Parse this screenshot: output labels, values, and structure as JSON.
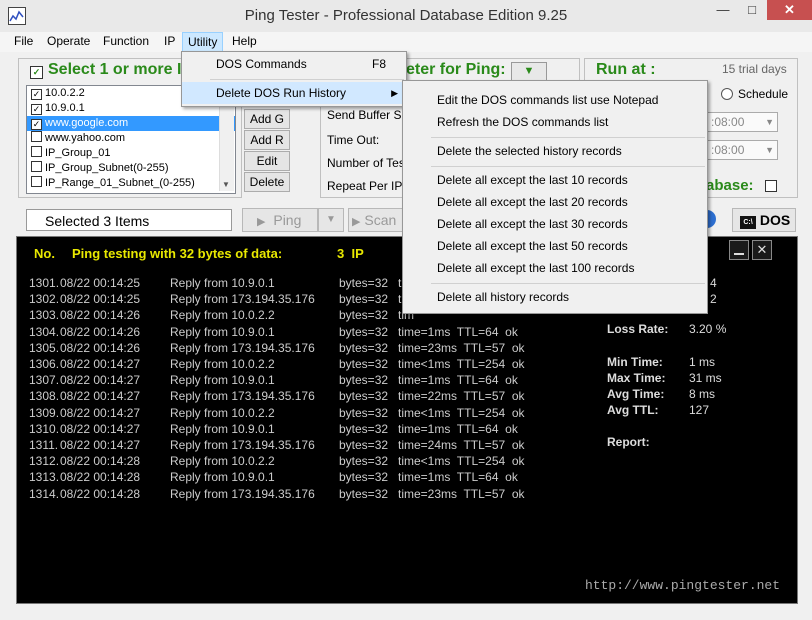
{
  "window": {
    "title": "Ping Tester - Professional Database Edition  9.25",
    "controls": {
      "minimize": "—",
      "maximize": "□",
      "close": "✕"
    }
  },
  "menubar": [
    "File",
    "Operate",
    "Function",
    "IP",
    "Utility",
    "Help"
  ],
  "left_panel": {
    "heading": "Select 1 or more I",
    "hosts": [
      {
        "label": "10.0.2.2",
        "checked": true
      },
      {
        "label": "10.9.0.1",
        "checked": true
      },
      {
        "label": "www.google.com",
        "checked": true,
        "selected": true
      },
      {
        "label": "www.yahoo.com",
        "checked": false
      },
      {
        "label": "IP_Group_01",
        "checked": false
      },
      {
        "label": "IP_Group_Subnet(0-255)",
        "checked": false
      },
      {
        "label": "IP_Range_01_Subnet_(0-255)",
        "checked": false
      }
    ],
    "buttons": [
      "Add G",
      "Add R",
      "Edit",
      "Delete"
    ]
  },
  "middle_panel": {
    "heading_suffix": "eter for Ping:",
    "labels": [
      "Send Buffer Siz",
      "Time Out:",
      "Number of Test",
      "Repeat Per IP:"
    ]
  },
  "right_panel": {
    "heading": "Run at :",
    "trial": "15 trial days",
    "schedule": "Schedule",
    "time1": ":08:00",
    "time2": ":08:00",
    "database_label": "abase:"
  },
  "toolbar": {
    "selected": "Selected 3 Items",
    "ping": "Ping",
    "scan": "Scan i",
    "dos": "DOS"
  },
  "console": {
    "header_no": "No.",
    "header_msg": "Ping testing with 32 bytes of data:",
    "header_count": "3  IP",
    "rows": [
      {
        "no": "1301.",
        "time": "08/22 00:14:25",
        "reply": "Reply from 10.9.0.1",
        "bytes": "bytes=32",
        "stat": "tim"
      },
      {
        "no": "1302.",
        "time": "08/22 00:14:25",
        "reply": "Reply from 173.194.35.176",
        "bytes": "bytes=32",
        "stat": "tim"
      },
      {
        "no": "1303.",
        "time": "08/22 00:14:26",
        "reply": "Reply from 10.0.2.2",
        "bytes": "bytes=32",
        "stat": "tim"
      },
      {
        "no": "1304.",
        "time": "08/22 00:14:26",
        "reply": "Reply from 10.9.0.1",
        "bytes": "bytes=32",
        "stat": "time=1ms  TTL=64  ok"
      },
      {
        "no": "1305.",
        "time": "08/22 00:14:26",
        "reply": "Reply from 173.194.35.176",
        "bytes": "bytes=32",
        "stat": "time=23ms  TTL=57  ok"
      },
      {
        "no": "1306.",
        "time": "08/22 00:14:27",
        "reply": "Reply from 10.0.2.2",
        "bytes": "bytes=32",
        "stat": "time<1ms  TTL=254  ok"
      },
      {
        "no": "1307.",
        "time": "08/22 00:14:27",
        "reply": "Reply from 10.9.0.1",
        "bytes": "bytes=32",
        "stat": "time=1ms  TTL=64  ok"
      },
      {
        "no": "1308.",
        "time": "08/22 00:14:27",
        "reply": "Reply from 173.194.35.176",
        "bytes": "bytes=32",
        "stat": "time=22ms  TTL=57  ok"
      },
      {
        "no": "1309.",
        "time": "08/22 00:14:27",
        "reply": "Reply from 10.0.2.2",
        "bytes": "bytes=32",
        "stat": "time<1ms  TTL=254  ok"
      },
      {
        "no": "1310.",
        "time": "08/22 00:14:27",
        "reply": "Reply from 10.9.0.1",
        "bytes": "bytes=32",
        "stat": "time=1ms  TTL=64  ok"
      },
      {
        "no": "1311.",
        "time": "08/22 00:14:27",
        "reply": "Reply from 173.194.35.176",
        "bytes": "bytes=32",
        "stat": "time=24ms  TTL=57  ok"
      },
      {
        "no": "1312.",
        "time": "08/22 00:14:28",
        "reply": "Reply from 10.0.2.2",
        "bytes": "bytes=32",
        "stat": "time<1ms  TTL=254  ok"
      },
      {
        "no": "1313.",
        "time": "08/22 00:14:28",
        "reply": "Reply from 10.9.0.1",
        "bytes": "bytes=32",
        "stat": "time=1ms  TTL=64  ok"
      },
      {
        "no": "1314.",
        "time": "08/22 00:14:28",
        "reply": "Reply from 173.194.35.176",
        "bytes": "bytes=32",
        "stat": "time=23ms  TTL=57  ok"
      }
    ],
    "partial_values": [
      "4",
      "2"
    ],
    "stats": [
      {
        "label": "Loss Rate:",
        "value": "3.20 %"
      },
      {
        "label": "Min Time:",
        "value": "1 ms"
      },
      {
        "label": "Max Time:",
        "value": "31 ms"
      },
      {
        "label": "Avg Time:",
        "value": "8 ms"
      },
      {
        "label": "Avg TTL:",
        "value": "127"
      },
      {
        "label": "Report:",
        "value": ""
      }
    ],
    "url": "http://www.pingtester.net"
  },
  "utility_menu": {
    "items": [
      {
        "label": "DOS Commands",
        "shortcut": "F8"
      },
      {
        "label": "Delete DOS Run History",
        "submenu": true
      }
    ]
  },
  "submenu": {
    "items": [
      "Edit the DOS commands list use Notepad",
      "Refresh the DOS commands list",
      "Delete the selected history records",
      "Delete all except the last 10 records",
      "Delete all except the last 20 records",
      "Delete all except the last 30 records",
      "Delete all except the last 50 records",
      "Delete all except the last 100 records",
      "Delete all history records"
    ]
  },
  "colors": {
    "accent_green": "#2a8a1a",
    "console_header": "#e8e800",
    "selection": "#3399ff"
  }
}
